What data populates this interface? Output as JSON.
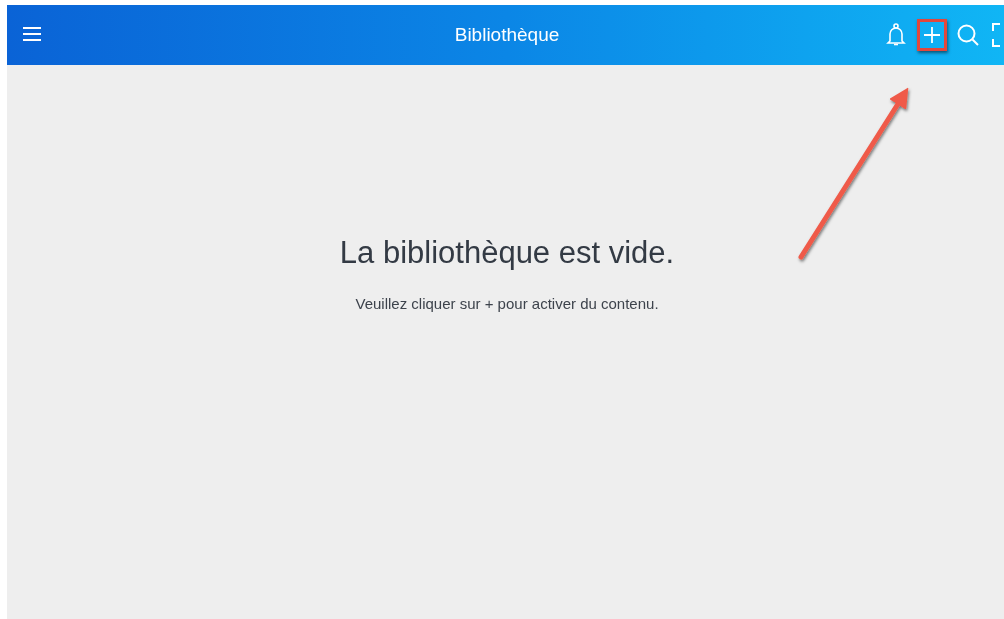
{
  "header": {
    "title": "Bibliothèque"
  },
  "actions": [
    {
      "kind": "bell",
      "highlighted": false
    },
    {
      "kind": "add",
      "highlighted": true
    },
    {
      "kind": "search",
      "highlighted": false
    },
    {
      "kind": "fullscreen",
      "highlighted": false
    }
  ],
  "empty_state": {
    "heading": "La bibliothèque est vide.",
    "hint": "Veuillez cliquer sur + pour activer du contenu."
  }
}
